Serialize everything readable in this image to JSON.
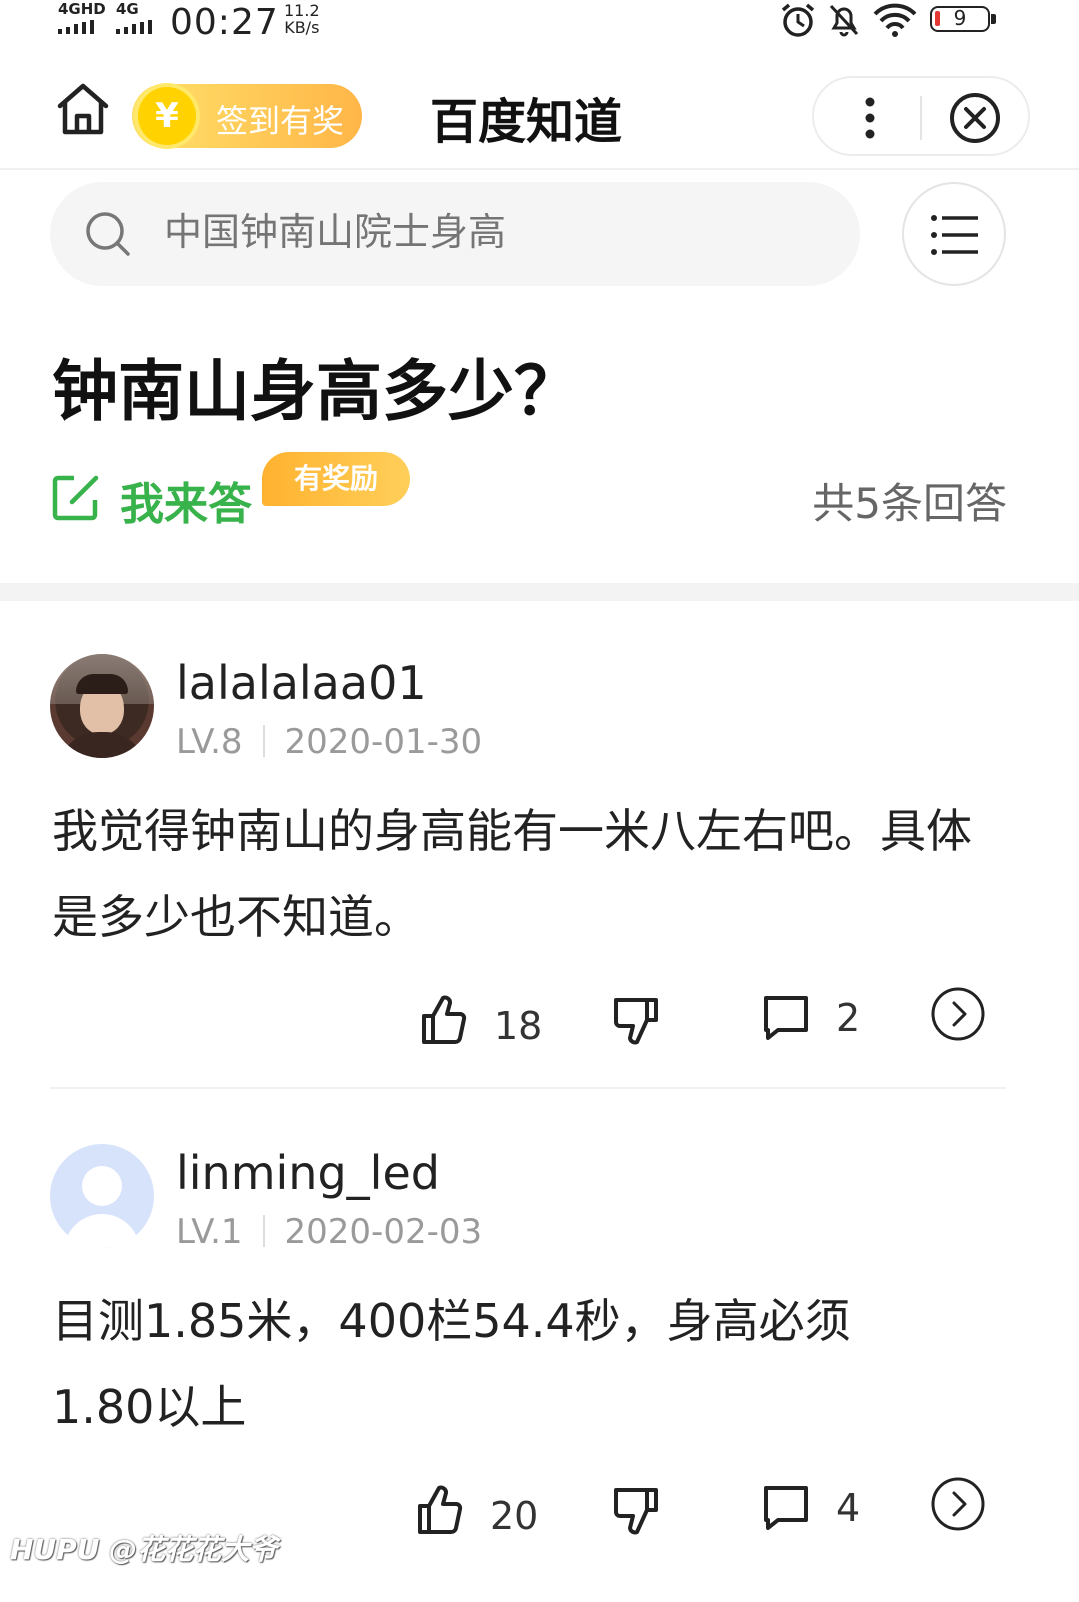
{
  "status_bar": {
    "sim1": "4GHD",
    "sim2": "4G",
    "time": "00:27",
    "speed_value": "11.2",
    "speed_unit": "KB/s",
    "battery": "9"
  },
  "header": {
    "signin_label": "签到有奖",
    "coin_symbol": "¥",
    "app_title": "百度知道"
  },
  "search": {
    "placeholder": "中国钟南山院士身高"
  },
  "question": {
    "title": "钟南山身高多少？",
    "answer_label": "我来答",
    "reward_badge": "有奖励",
    "answer_count": "共5条回答"
  },
  "answers": [
    {
      "username": "lalalalaa01",
      "level": "LV.8",
      "date": "2020-01-30",
      "text": "我觉得钟南山的身高能有一米八左右吧。具体是多少也不知道。",
      "likes": "18",
      "comments": "2"
    },
    {
      "username": "linming_led",
      "level": "LV.1",
      "date": "2020-02-03",
      "text": "目测1.85米，400栏54.4秒，身高必须1.80以上",
      "likes": "20",
      "comments": "4"
    }
  ],
  "watermark": "HUPU @花花花大爷",
  "colors": {
    "green": "#38b24a",
    "reward_orange": "#ffb22f",
    "coin_yellow": "#ffd200"
  }
}
